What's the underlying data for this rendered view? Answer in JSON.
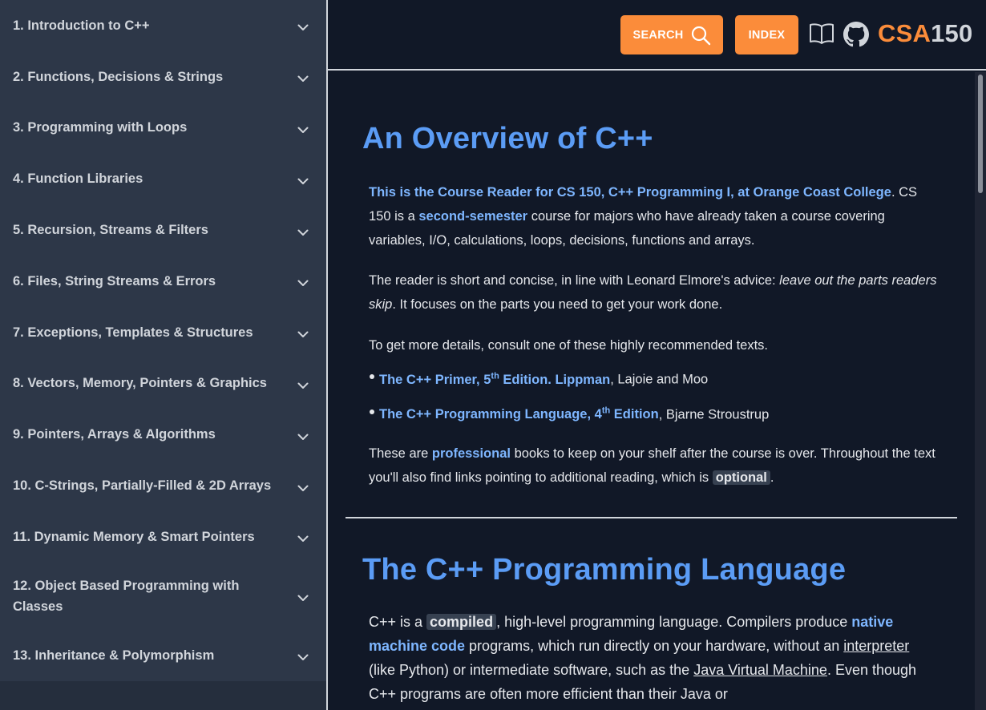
{
  "sidebar": {
    "items": [
      {
        "label": "1. Introduction to C++"
      },
      {
        "label": "2. Functions, Decisions & Strings"
      },
      {
        "label": "3. Programming with Loops"
      },
      {
        "label": "4. Function Libraries"
      },
      {
        "label": "5. Recursion, Streams & Filters"
      },
      {
        "label": "6. Files, String Streams & Errors"
      },
      {
        "label": "7. Exceptions, Templates & Structures"
      },
      {
        "label": "8. Vectors, Memory, Pointers & Graphics"
      },
      {
        "label": "9. Pointers, Arrays & Algorithms"
      },
      {
        "label": "10. C-Strings, Partially-Filled & 2D Arrays"
      },
      {
        "label": "11. Dynamic Memory & Smart Pointers"
      },
      {
        "label": "12. Object Based Programming with Classes"
      },
      {
        "label": "13. Inheritance & Polymorphism"
      }
    ]
  },
  "header": {
    "search_label": "SEARCH",
    "index_label": "INDEX",
    "brand_prefix": "CSA",
    "brand_suffix": "150",
    "icons": [
      "book-icon",
      "github-icon",
      "search-icon"
    ]
  },
  "colors": {
    "accent": "#fb8c3a",
    "heading": "#5b9cf5",
    "link": "#7eb6ff",
    "sidebar_bg": "#2d3748",
    "page_bg": "#111827"
  },
  "content": {
    "heading1": "An Overview of C++",
    "p1": {
      "link1": "This is the Course Reader for CS 150, C++ Programming I, at Orange Coast College",
      "t1": ". CS 150 is a ",
      "link2": "second-semester",
      "t2": " course for majors who have already taken a course covering variables, I/O, calculations, loops, decisions, functions and arrays."
    },
    "p2": {
      "t1": "The reader is short and concise, in line with Leonard Elmore's advice: ",
      "em": "leave out the parts readers skip",
      "t2": ". It focuses on the parts you need to get your work done."
    },
    "p3": "To get more details, consult one of these highly recommended texts.",
    "books": [
      {
        "link_a": "The C++ Primer, 5",
        "sup": "th",
        "link_b": " Edition. Lippman",
        "rest": ", Lajoie and Moo"
      },
      {
        "link_a": "The C++ Programming Language, 4",
        "sup": "th",
        "link_b": " Edition",
        "rest": ", Bjarne Stroustrup"
      }
    ],
    "p4": {
      "t1": "These are ",
      "link": "professional",
      "t2": " books to keep on your shelf after the course is over. Throughout the text you'll also find links pointing to additional reading, which is ",
      "code": "optional",
      "t3": "."
    },
    "heading2": "The C++ Programming Language",
    "p5": {
      "t1": "C++ is a ",
      "code": "compiled",
      "t2": ", high-level programming language. Compilers produce ",
      "link": "native machine code",
      "t3": " programs, which run directly on your hardware, without an ",
      "u1": "interpreter ",
      "t4": "(like Python) or intermediate software, such as the ",
      "u2": "Java Virtual Machine",
      "t5": ". Even though C++ programs are often more efficient than their Java or"
    }
  }
}
